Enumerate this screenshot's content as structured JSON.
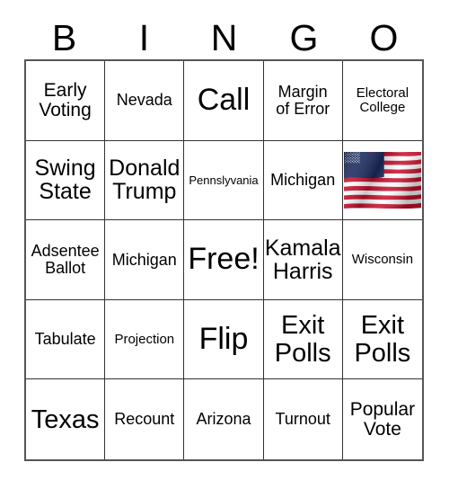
{
  "header": {
    "letters": [
      "B",
      "I",
      "N",
      "G",
      "O"
    ]
  },
  "grid": {
    "rows": 5,
    "columns": 5,
    "cells": [
      {
        "text": "Early\nVoting",
        "size": "lg",
        "type": "text"
      },
      {
        "text": "Nevada",
        "size": "md",
        "type": "text"
      },
      {
        "text": "Call",
        "size": "huge",
        "type": "text"
      },
      {
        "text": "Margin\nof Error",
        "size": "md",
        "type": "text"
      },
      {
        "text": "Electoral\nCollege",
        "size": "sm",
        "type": "text"
      },
      {
        "text": "Swing\nState",
        "size": "xl",
        "type": "text"
      },
      {
        "text": "Donald\nTrump",
        "size": "xl",
        "type": "text"
      },
      {
        "text": "Pennslyvania",
        "size": "xs",
        "type": "text"
      },
      {
        "text": "Michigan",
        "size": "md",
        "type": "text"
      },
      {
        "text": "",
        "size": "md",
        "type": "image",
        "image": "us-flag"
      },
      {
        "text": "Adsentee\nBallot",
        "size": "md",
        "type": "text"
      },
      {
        "text": "Michigan",
        "size": "md",
        "type": "text"
      },
      {
        "text": "Free!",
        "size": "huge",
        "type": "text"
      },
      {
        "text": "Kamala\nHarris",
        "size": "xl",
        "type": "text"
      },
      {
        "text": "Wisconsin",
        "size": "sm",
        "type": "text"
      },
      {
        "text": "Tabulate",
        "size": "md",
        "type": "text"
      },
      {
        "text": "Projection",
        "size": "sm",
        "type": "text"
      },
      {
        "text": "Flip",
        "size": "huge",
        "type": "text"
      },
      {
        "text": "Exit\nPolls",
        "size": "xxl",
        "type": "text"
      },
      {
        "text": "Exit\nPolls",
        "size": "xxl",
        "type": "text"
      },
      {
        "text": "Texas",
        "size": "xxl",
        "type": "text"
      },
      {
        "text": "Recount",
        "size": "md",
        "type": "text"
      },
      {
        "text": "Arizona",
        "size": "md",
        "type": "text"
      },
      {
        "text": "Turnout",
        "size": "md",
        "type": "text"
      },
      {
        "text": "Popular\nVote",
        "size": "lg",
        "type": "text"
      }
    ]
  },
  "colors": {
    "background": "#ffffff",
    "text": "#000000",
    "grid_line": "#333333",
    "grid_outer": "#555555",
    "flag_red": "#c8102e",
    "flag_blue": "#1b2a5e",
    "flag_white": "#ffffff"
  }
}
